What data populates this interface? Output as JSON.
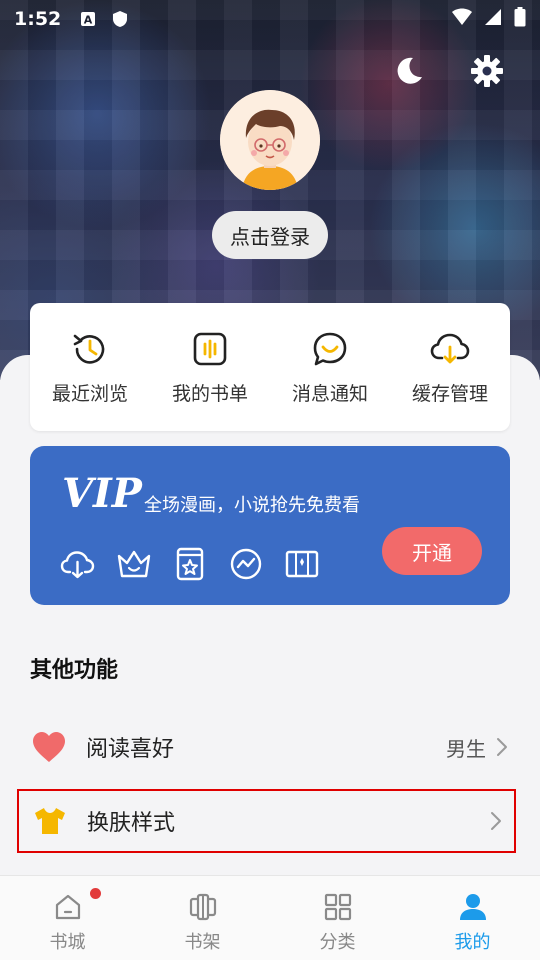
{
  "status_bar": {
    "time": "1:52",
    "icons": [
      "text-a-icon",
      "shield-icon",
      "wifi-icon",
      "signal-icon",
      "battery-icon"
    ]
  },
  "header": {
    "actions": [
      "moon-icon",
      "settings-gear-icon"
    ],
    "login_label": "点击登录"
  },
  "shortcuts": [
    {
      "label": "最近浏览",
      "icon": "history-clock-icon"
    },
    {
      "label": "我的书单",
      "icon": "booklist-icon"
    },
    {
      "label": "消息通知",
      "icon": "message-bubble-icon"
    },
    {
      "label": "缓存管理",
      "icon": "cloud-download-icon"
    }
  ],
  "vip": {
    "title": "VIP",
    "subtitle": "全场漫画，小说抢先免费看",
    "button_label": "开通",
    "icons": [
      "cloud-download-icon",
      "crown-icon",
      "book-star-icon",
      "chart-circle-icon",
      "ticket-icon"
    ],
    "colors": {
      "card": "#3b6cc5",
      "button": "#f26a6a"
    }
  },
  "other": {
    "title": "其他功能",
    "rows": [
      {
        "label": "阅读喜好",
        "value": "男生",
        "icon": "heart-icon"
      },
      {
        "label": "换肤样式",
        "value": "",
        "icon": "tshirt-icon"
      }
    ]
  },
  "nav": {
    "items": [
      {
        "label": "书城",
        "icon": "home-icon",
        "active": false,
        "badge": true
      },
      {
        "label": "书架",
        "icon": "bookshelf-icon",
        "active": false
      },
      {
        "label": "分类",
        "icon": "category-grid-icon",
        "active": false
      },
      {
        "label": "我的",
        "icon": "user-icon",
        "active": true
      }
    ],
    "active_color": "#1c9bea"
  }
}
